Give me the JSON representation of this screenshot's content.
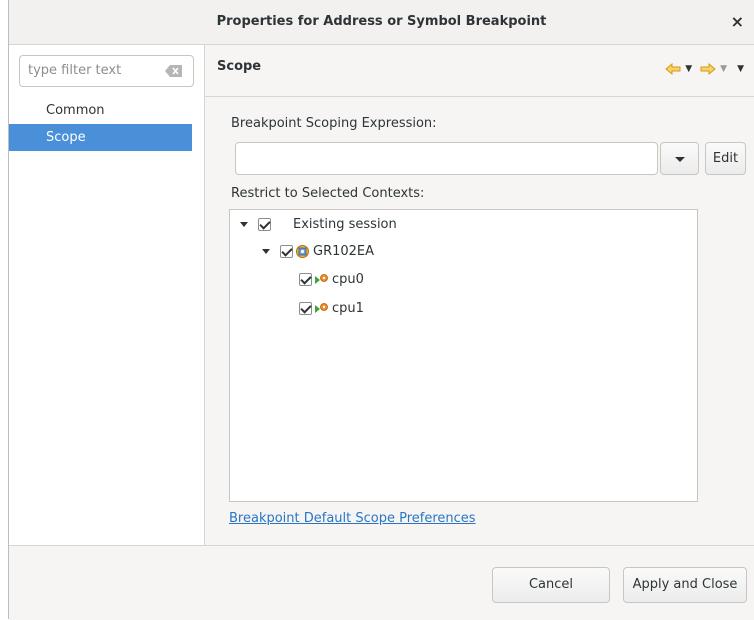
{
  "window": {
    "title": "Properties for Address or Symbol Breakpoint",
    "close_glyph": "×"
  },
  "sidebar": {
    "filter_placeholder": "type filter text",
    "items": [
      {
        "label": "Common",
        "selected": false
      },
      {
        "label": "Scope",
        "selected": true
      }
    ]
  },
  "page": {
    "title": "Scope",
    "expression_label": "Breakpoint Scoping Expression:",
    "expression_value": "",
    "edit_label": "Edit",
    "contexts_label": "Restrict to Selected Contexts:",
    "tree": {
      "session": {
        "label": "Existing session",
        "checked": true,
        "expanded": true
      },
      "target": {
        "label": "GR102EA",
        "checked": true,
        "expanded": true
      },
      "cores": [
        {
          "label": "cpu0",
          "checked": true
        },
        {
          "label": "cpu1",
          "checked": true
        }
      ]
    },
    "preferences_link": "Breakpoint Default Scope Preferences"
  },
  "footer": {
    "cancel_label": "Cancel",
    "apply_label": "Apply and Close"
  },
  "colors": {
    "selection": "#4a90d9",
    "link": "#2a76c6",
    "nav_arrow": "#e8a317"
  }
}
